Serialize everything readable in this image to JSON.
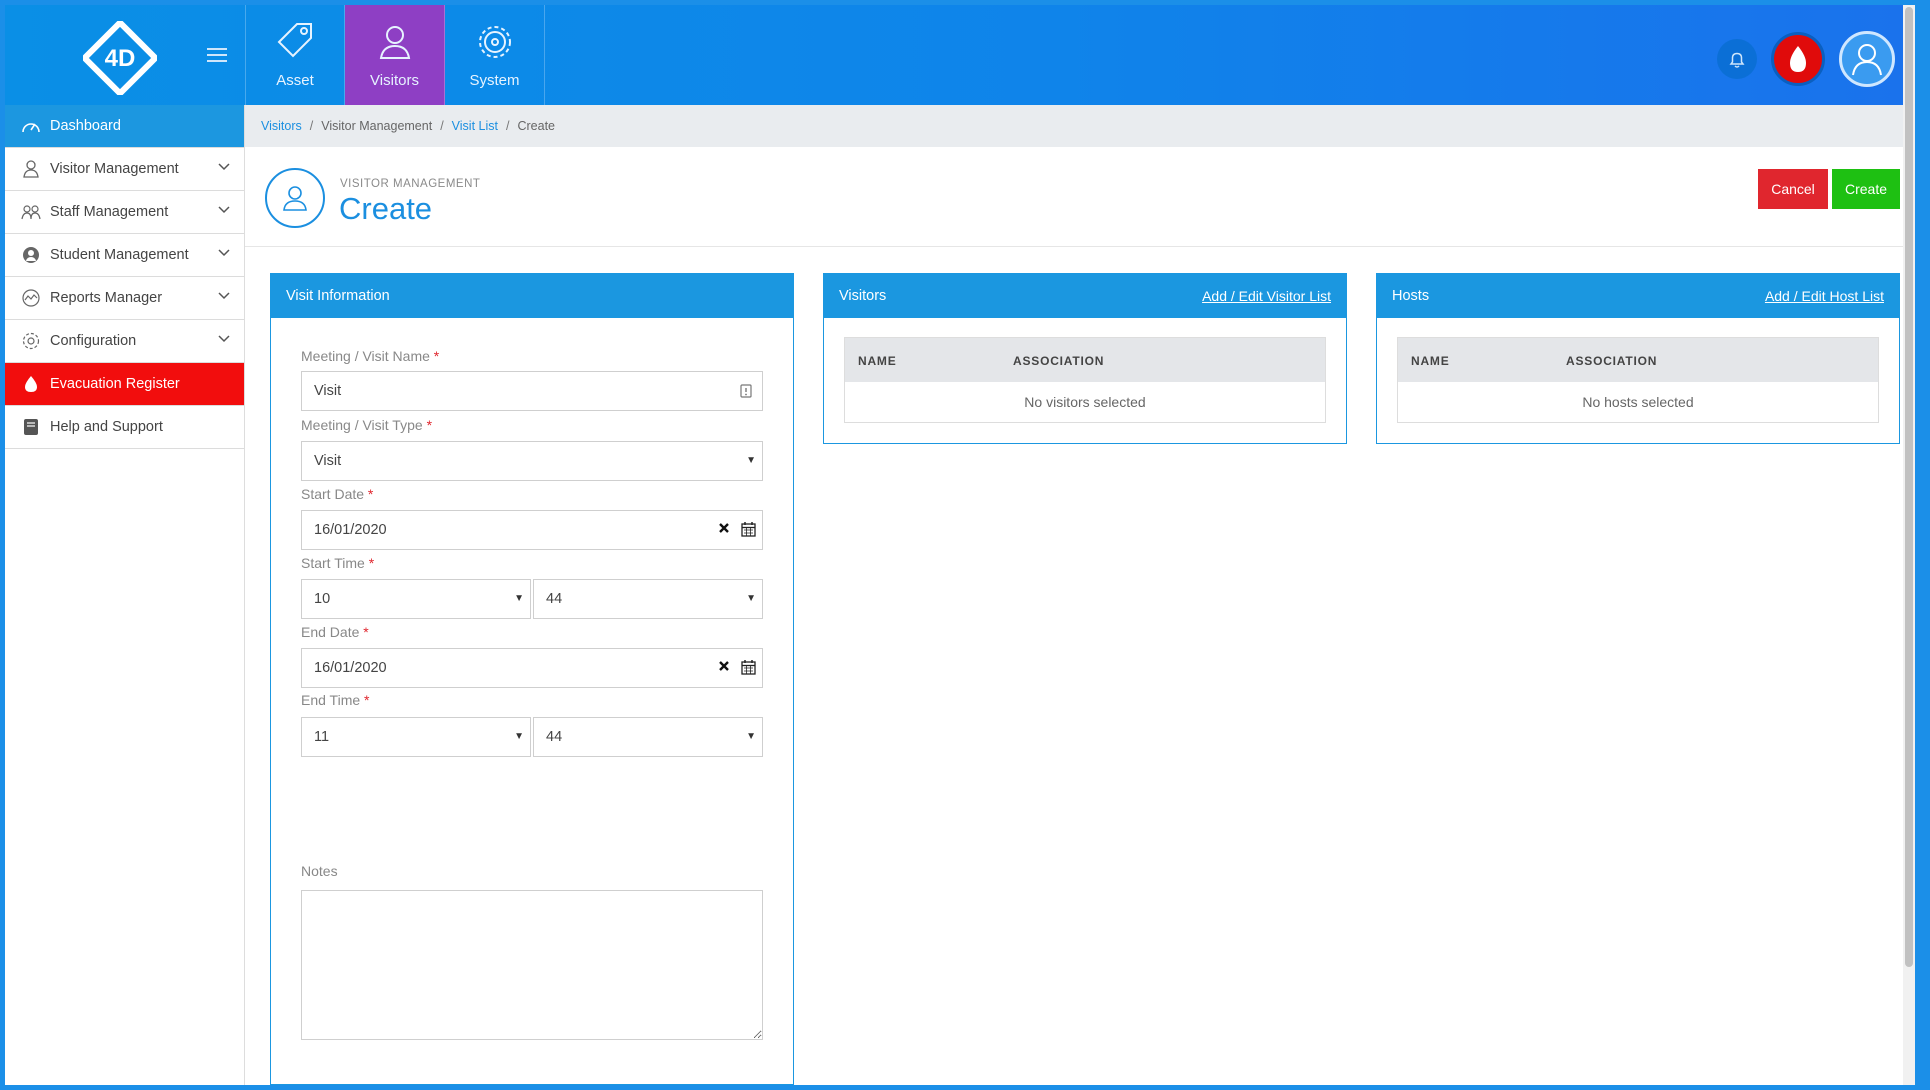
{
  "topbar": {
    "logo_text": "4D",
    "tabs": [
      {
        "label": "Asset",
        "icon": "tag-icon"
      },
      {
        "label": "Visitors",
        "icon": "person-icon",
        "active": true
      },
      {
        "label": "System",
        "icon": "cog-icon"
      }
    ]
  },
  "sidebar": {
    "items": [
      {
        "label": "Dashboard",
        "icon": "speedometer-icon"
      },
      {
        "label": "Visitor Management",
        "icon": "person-icon"
      },
      {
        "label": "Staff Management",
        "icon": "group-icon"
      },
      {
        "label": "Student Management",
        "icon": "user-circle-icon"
      },
      {
        "label": "Reports Manager",
        "icon": "chart-icon"
      },
      {
        "label": "Configuration",
        "icon": "gear-icon"
      },
      {
        "label": "Evacuation Register",
        "icon": "flame-icon"
      },
      {
        "label": "Help and Support",
        "icon": "book-icon"
      }
    ]
  },
  "breadcrumb": {
    "items": [
      "Visitors",
      "Visitor Management",
      "Visit List",
      "Create"
    ]
  },
  "header": {
    "subtitle": "VISITOR MANAGEMENT",
    "title": "Create",
    "cancel_label": "Cancel",
    "create_label": "Create"
  },
  "visit_info": {
    "title": "Visit Information",
    "name_label": "Meeting / Visit Name",
    "name_value": "Visit",
    "type_label": "Meeting / Visit Type",
    "type_value": "Visit",
    "start_date_label": "Start Date",
    "start_date_value": "16/01/2020",
    "start_time_label": "Start Time",
    "start_hour": "10",
    "start_minute": "44",
    "end_date_label": "End Date",
    "end_date_value": "16/01/2020",
    "end_time_label": "End Time",
    "end_hour": "11",
    "end_minute": "44",
    "notes_label": "Notes",
    "required_mark": "*"
  },
  "visitors_panel": {
    "title": "Visitors",
    "link": "Add / Edit Visitor List",
    "columns": [
      "NAME",
      "ASSOCIATION"
    ],
    "empty": "No visitors selected"
  },
  "hosts_panel": {
    "title": "Hosts",
    "link": "Add / Edit Host List",
    "columns": [
      "NAME",
      "ASSOCIATION"
    ],
    "empty": "No hosts selected"
  },
  "colors": {
    "primary": "#1b97e0",
    "active_tab": "#8e3fc4",
    "danger": "#e0262e",
    "success": "#1ec012",
    "evac": "#f20d0d"
  }
}
